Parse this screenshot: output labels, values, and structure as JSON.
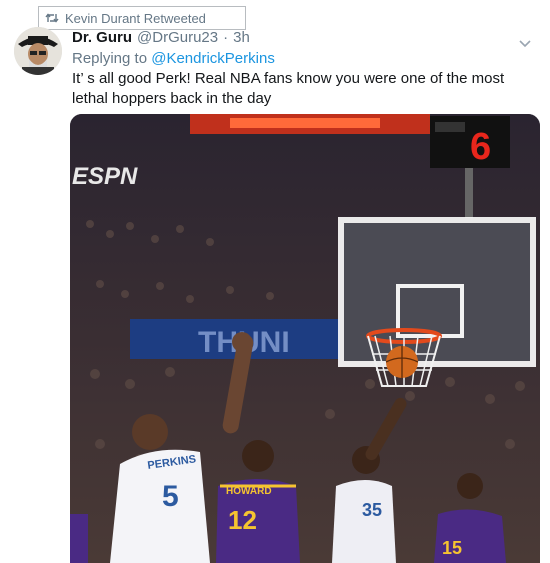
{
  "retweet": {
    "label": "Kevin Durant Retweeted",
    "icon": "retweet-icon"
  },
  "tweet": {
    "author_name": "Dr. Guru",
    "author_handle": "@DrGuru23",
    "separator": "·",
    "time": "3h",
    "reply_prefix": "Replying to",
    "reply_to": "@KendrickPerkins",
    "text": "It’ s all good Perk! Real NBA fans know you were one of the most lethal hoppers back in the day"
  },
  "media": {
    "arena_logo": "ESPN",
    "banner_text": "THUNI",
    "shot_clock": "6",
    "players": [
      {
        "team": "thunder",
        "name": "PERKINS",
        "number": "5"
      },
      {
        "team": "lakers",
        "name": "HOWARD",
        "number": "12"
      },
      {
        "team": "thunder",
        "name": "",
        "number": "35"
      },
      {
        "team": "lakers",
        "name": "",
        "number": "15"
      }
    ]
  },
  "colors": {
    "link": "#1b95e0",
    "secondary_text": "#657786",
    "thunder_blue": "#1b3f8b",
    "lakers_purple": "#4a2a84",
    "lakers_gold": "#f5c430"
  }
}
